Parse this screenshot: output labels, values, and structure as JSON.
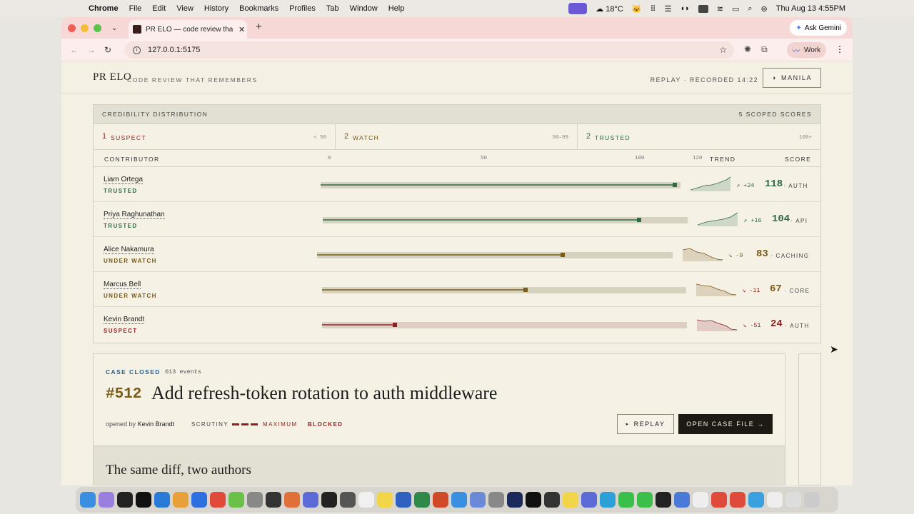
{
  "menubar": {
    "app": "Chrome",
    "items": [
      "File",
      "Edit",
      "View",
      "History",
      "Bookmarks",
      "Profiles",
      "Tab",
      "Window",
      "Help"
    ],
    "weather": "18°C",
    "datetime": "Thu Aug 13  4:55PM"
  },
  "browser": {
    "tab_title": "PR ELO — code review that re",
    "ask_gemini": "Ask Gemini",
    "url": "127.0.0.1:5175",
    "profile": "Work"
  },
  "header": {
    "brand": "PR ELO",
    "tagline": "CODE REVIEW THAT REMEMBERS",
    "replay_info": "REPLAY · RECORDED 14:22",
    "theme_button": "MANILA"
  },
  "distribution": {
    "title": "CREDIBILITY DISTRIBUTION",
    "scoped": "5 SCOPED SCORES",
    "cohorts": [
      {
        "count": "1",
        "label": "SUSPECT",
        "range": "< 50",
        "color": "#8c1f1f"
      },
      {
        "count": "2",
        "label": "WATCH",
        "range": "50–99",
        "color": "#7a5a14"
      },
      {
        "count": "2",
        "label": "TRUSTED",
        "range": "100+",
        "color": "#2f6a44"
      }
    ],
    "columns": {
      "contributor": "CONTRIBUTOR",
      "ticks": [
        "0",
        "50",
        "100",
        "120"
      ],
      "trend": "TREND",
      "score": "SCORE"
    },
    "rows": [
      {
        "name": "Liam Ortega",
        "tier": "TRUSTED",
        "delta": "↗ +24",
        "score": "118",
        "area": "· AUTH",
        "value": 118,
        "color": "#2f6a44"
      },
      {
        "name": "Priya Raghunathan",
        "tier": "TRUSTED",
        "delta": "↗ +16",
        "score": "104",
        "area": "· API",
        "value": 104,
        "color": "#2f6a44"
      },
      {
        "name": "Alice Nakamura",
        "tier": "UNDER WATCH",
        "delta": "↘ -9",
        "score": "83",
        "area": "· CACHING",
        "value": 83,
        "color": "#7a5a14"
      },
      {
        "name": "Marcus Bell",
        "tier": "UNDER WATCH",
        "delta": "↘ -11",
        "score": "67",
        "area": "· CORE",
        "value": 67,
        "color": "#7a5a14"
      },
      {
        "name": "Kevin Brandt",
        "tier": "SUSPECT",
        "delta": "↘ -51",
        "score": "24",
        "area": "· AUTH",
        "value": 24,
        "color": "#8c1f1f"
      }
    ]
  },
  "case": {
    "status": "CASE CLOSED",
    "events": "013 events",
    "number": "#512",
    "title": "Add refresh-token rotation to auth middleware",
    "opened_prefix": "opened by",
    "opened_by": "Kevin Brandt",
    "scrutiny_label": "SCRUTINY",
    "scrutiny_level": "MAXIMUM",
    "state": "BLOCKED",
    "replay_button": "REPLAY",
    "open_button": "OPEN CASE FILE →",
    "section_title": "The same diff, two authors"
  }
}
